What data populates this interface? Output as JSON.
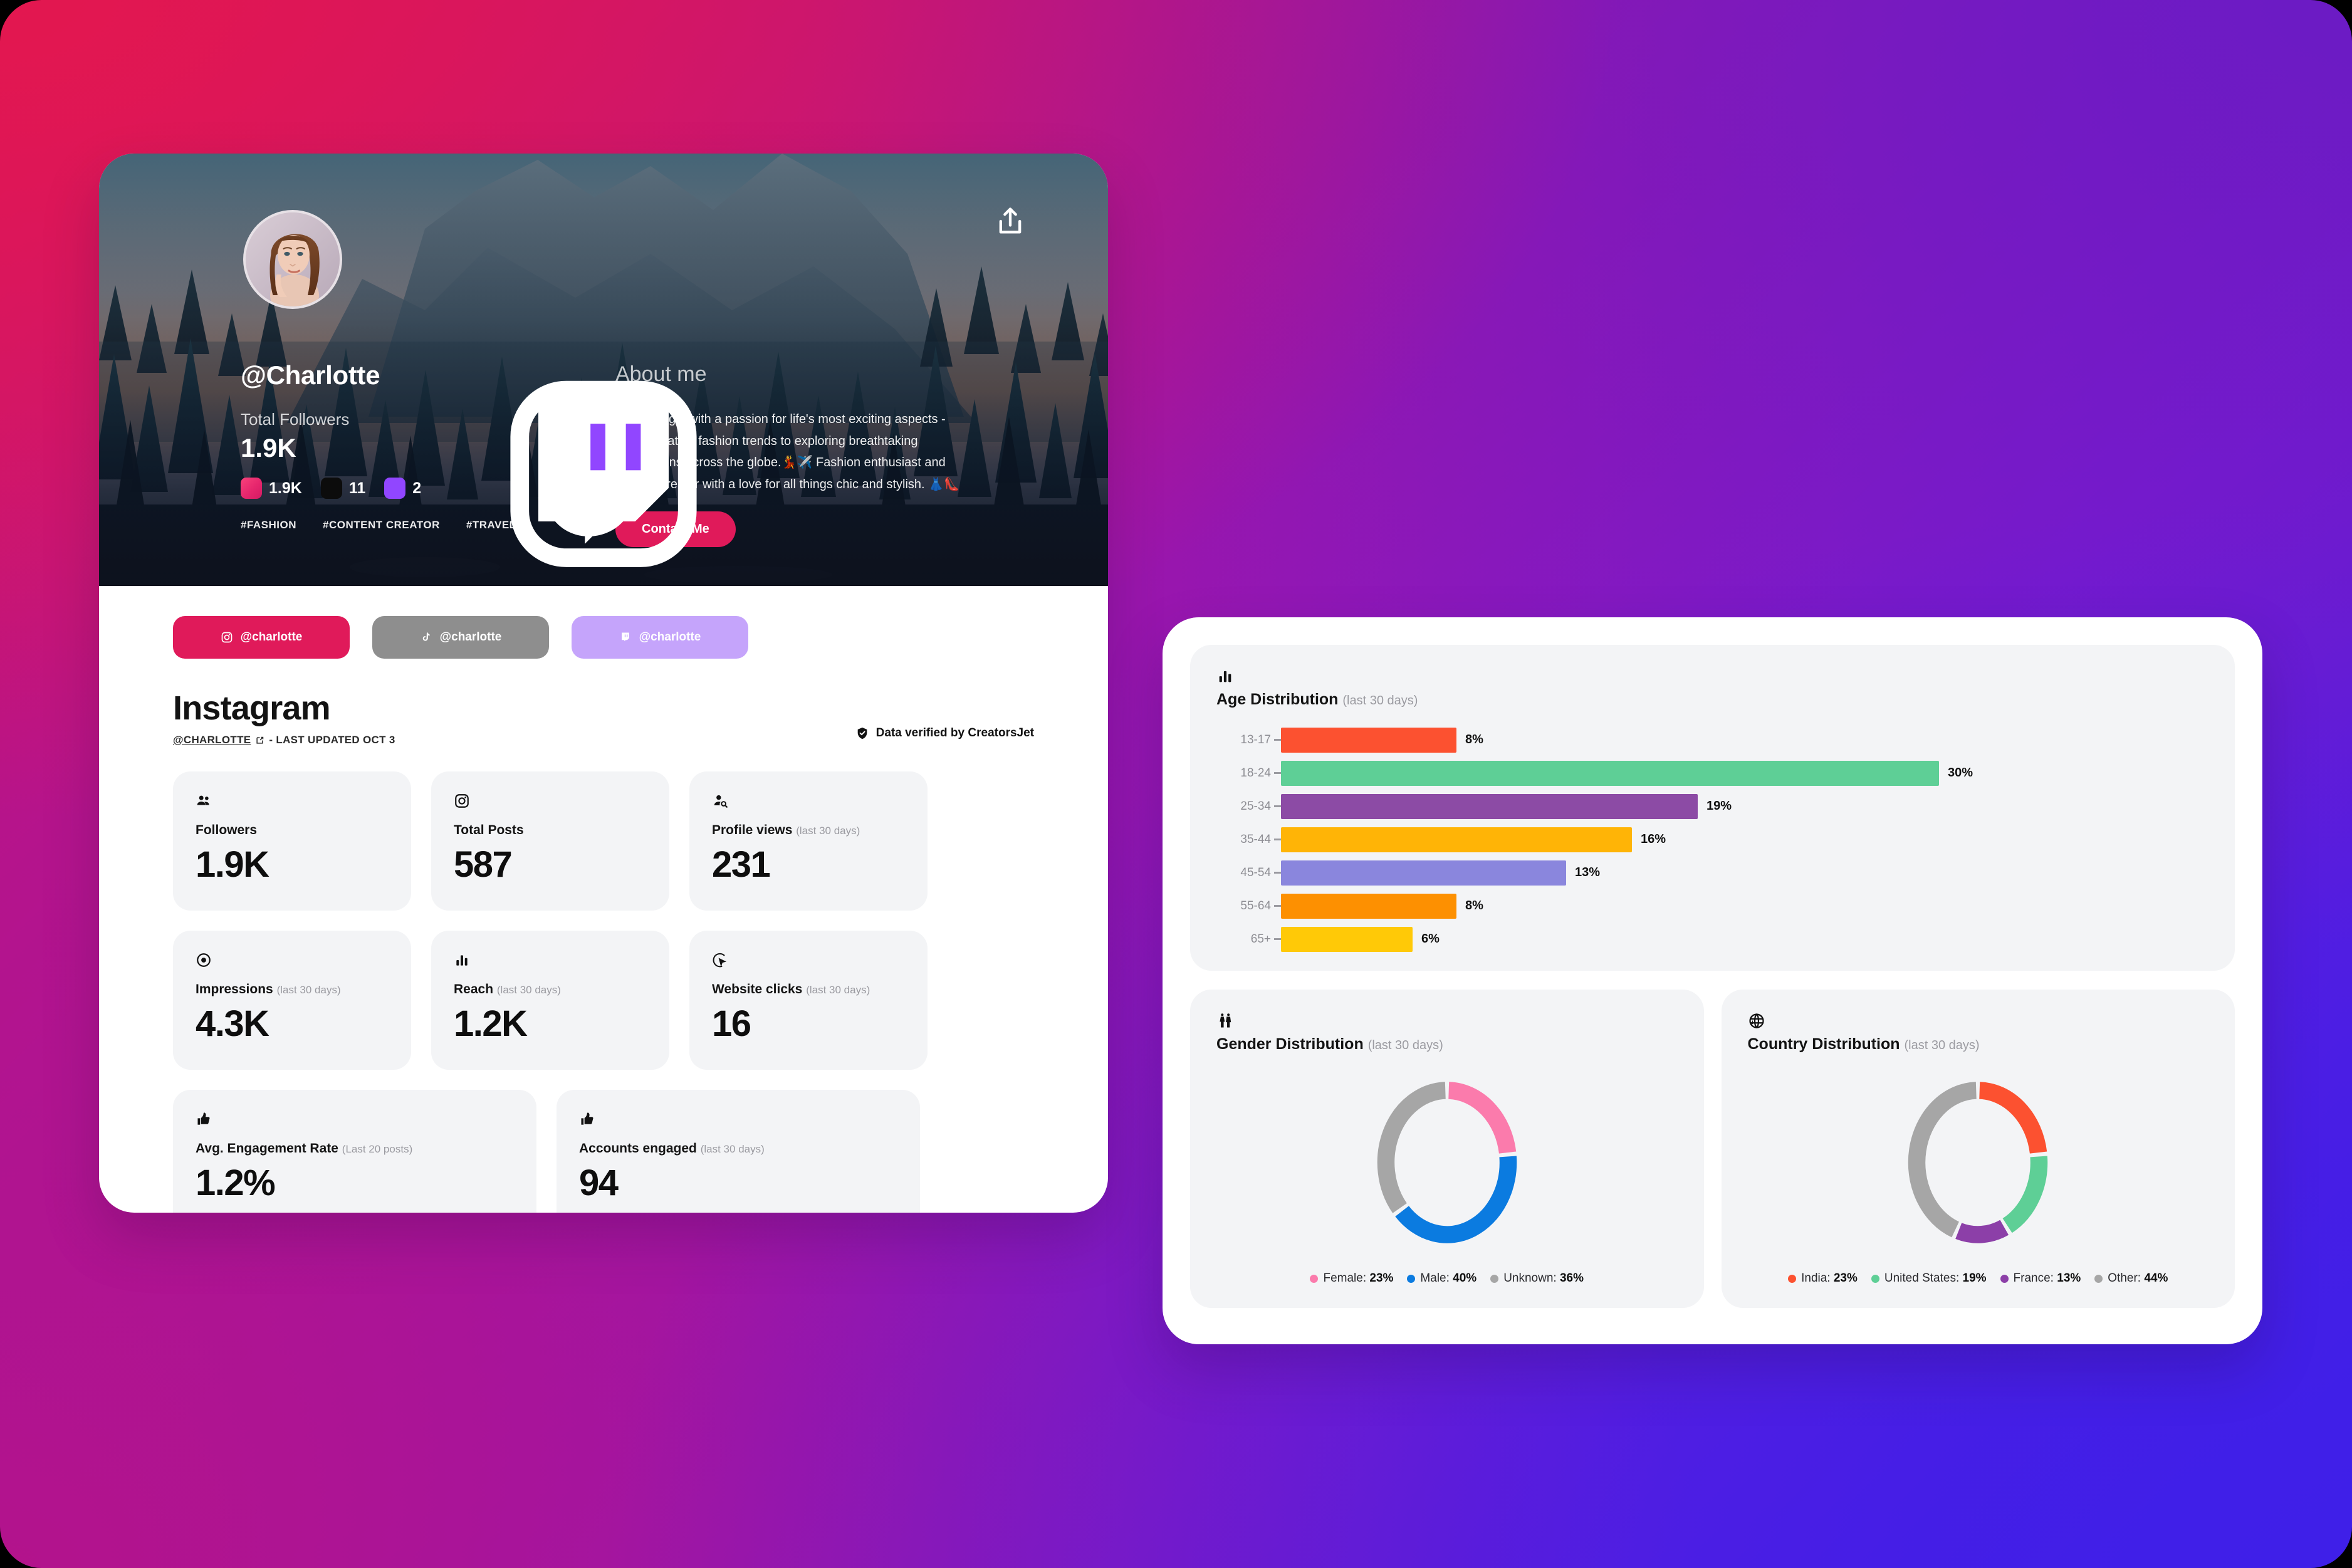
{
  "background": {
    "c_topleft": "#e3174f",
    "c_topright": "#6b1bc4",
    "c_bottomright": "#3f1fe8",
    "c_bottomleft": "#b3138c"
  },
  "profile": {
    "handle": "@Charlotte",
    "followers_label": "Total Followers",
    "followers_value": "1.9K",
    "share_icon": "share-icon",
    "avatar_icon": "avatar-portrait",
    "social_stats": [
      {
        "icon": "instagram-icon",
        "count": "1.9K",
        "color": "#e6266d"
      },
      {
        "icon": "tiktok-icon",
        "count": "11",
        "color": "#0c0c0c"
      },
      {
        "icon": "twitch-icon",
        "count": "2",
        "color": "#9146ff"
      }
    ],
    "tags": [
      "#FASHION",
      "#CONTENT CREATOR",
      "#TRAVEL"
    ],
    "about_title": "About me",
    "about_text": "I'm just a girl with a passion for life's most exciting aspects - from the latest fashion trends to exploring breathtaking destinations across the globe.💃✈️ Fashion enthusiast and content creator with a love for all things chic and stylish. 👗👠",
    "contact_label": "Contact Me",
    "contact_color": "#e01a5a"
  },
  "platform_pills": [
    {
      "icon": "instagram-icon",
      "label": "@charlotte",
      "color": "#e01a5a"
    },
    {
      "icon": "tiktok-icon",
      "label": "@charlotte",
      "color": "#8e8e8e"
    },
    {
      "icon": "twitch-icon",
      "label": "@charlotte",
      "color": "#c5a4fb"
    }
  ],
  "platform": {
    "name": "Instagram",
    "handle_link": "@CHARLOTTE",
    "updated": "- LAST UPDATED OCT 3",
    "verified_text": "Data verified by CreatorsJet"
  },
  "stats": [
    [
      {
        "icon": "people-icon",
        "label": "Followers",
        "period": "",
        "value": "1.9K",
        "width": "w1"
      },
      {
        "icon": "instagram-icon",
        "label": "Total Posts",
        "period": "",
        "value": "587",
        "width": "w1"
      },
      {
        "icon": "profile-search-icon",
        "label": "Profile views",
        "period": "(last 30 days)",
        "value": "231",
        "width": "w1"
      }
    ],
    [
      {
        "icon": "eye-icon",
        "label": "Impressions",
        "period": "(last 30 days)",
        "value": "4.3K",
        "width": "w1"
      },
      {
        "icon": "bar-chart-icon",
        "label": "Reach",
        "period": "(last 30 days)",
        "value": "1.2K",
        "width": "w1"
      },
      {
        "icon": "cursor-click-icon",
        "label": "Website clicks",
        "period": "(last 30 days)",
        "value": "16",
        "width": "w1"
      }
    ],
    [
      {
        "icon": "thumbs-up-icon",
        "label": "Avg. Engagement Rate",
        "period": "(Last 20 posts)",
        "value": "1.2%",
        "width": "w2"
      },
      {
        "icon": "thumbs-up-icon",
        "label": "Accounts engaged",
        "period": "(last 30 days)",
        "value": "94",
        "width": "w2"
      }
    ]
  ],
  "analytics": {
    "age": {
      "icon": "bar-chart-icon",
      "title": "Age Distribution",
      "period": "(last 30 days)"
    },
    "gender": {
      "icon": "gender-icon",
      "title": "Gender Distribution",
      "period": "(last 30 days)"
    },
    "country": {
      "icon": "globe-icon",
      "title": "Country Distribution",
      "period": "(last 30 days)"
    }
  },
  "chart_data": [
    {
      "type": "bar",
      "orientation": "horizontal",
      "title": "Age Distribution",
      "subtitle": "(last 30 days)",
      "xlabel": "",
      "ylabel": "",
      "grid": false,
      "categories": [
        "13-17",
        "18-24",
        "25-34",
        "35-44",
        "45-54",
        "55-64",
        "65+"
      ],
      "values": [
        8,
        30,
        19,
        16,
        13,
        8,
        6
      ],
      "value_labels": [
        "8%",
        "30%",
        "19%",
        "16%",
        "13%",
        "8%",
        "6%"
      ],
      "colors": [
        "#fc5130",
        "#5ecf96",
        "#8c4ba5",
        "#ffb406",
        "#8a86dd",
        "#fd9001",
        "#ffc907"
      ],
      "xlim": [
        0,
        30
      ]
    },
    {
      "type": "pie",
      "variant": "donut",
      "title": "Gender Distribution",
      "subtitle": "(last 30 days)",
      "legend_position": "bottom",
      "labels": [
        "Female",
        "Male",
        "Unknown"
      ],
      "values": [
        23,
        40,
        36
      ],
      "value_labels": [
        "23%",
        "40%",
        "36%"
      ],
      "colors": [
        "#fb7bac",
        "#0b7be0",
        "#a6a6a6"
      ]
    },
    {
      "type": "pie",
      "variant": "donut",
      "title": "Country Distribution",
      "subtitle": "(last 30 days)",
      "legend_position": "bottom",
      "labels": [
        "India",
        "United States",
        "France",
        "Other"
      ],
      "values": [
        23,
        19,
        13,
        44
      ],
      "value_labels": [
        "23%",
        "19%",
        "13%",
        "44%"
      ],
      "colors": [
        "#fc5130",
        "#5ecf96",
        "#8c3fa8",
        "#a6a6a6"
      ]
    }
  ]
}
